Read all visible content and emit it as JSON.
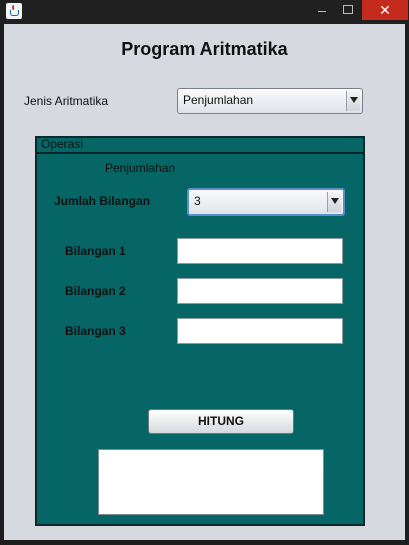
{
  "window": {
    "close_glyph": "✕"
  },
  "title": "Program Aritmatika",
  "jenis": {
    "label": "Jenis Aritmatika",
    "selected": "Penjumlahan"
  },
  "panel": {
    "title": "Operasi",
    "mode": "Penjumlahan",
    "jumlah_label": "Jumlah Bilangan",
    "jumlah_selected": "3",
    "fields": [
      {
        "label": "Bilangan 1",
        "value": ""
      },
      {
        "label": "Bilangan 2",
        "value": ""
      },
      {
        "label": "Bilangan 3",
        "value": ""
      }
    ],
    "button_label": "HITUNG",
    "result": ""
  },
  "colors": {
    "panel_bg": "#066565",
    "frame_bg": "#d6d9df",
    "close_bg": "#c42b1c"
  },
  "icons": [
    "java-app-icon",
    "minimize-icon",
    "maximize-icon",
    "close-icon",
    "dropdown-arrow-icon"
  ]
}
